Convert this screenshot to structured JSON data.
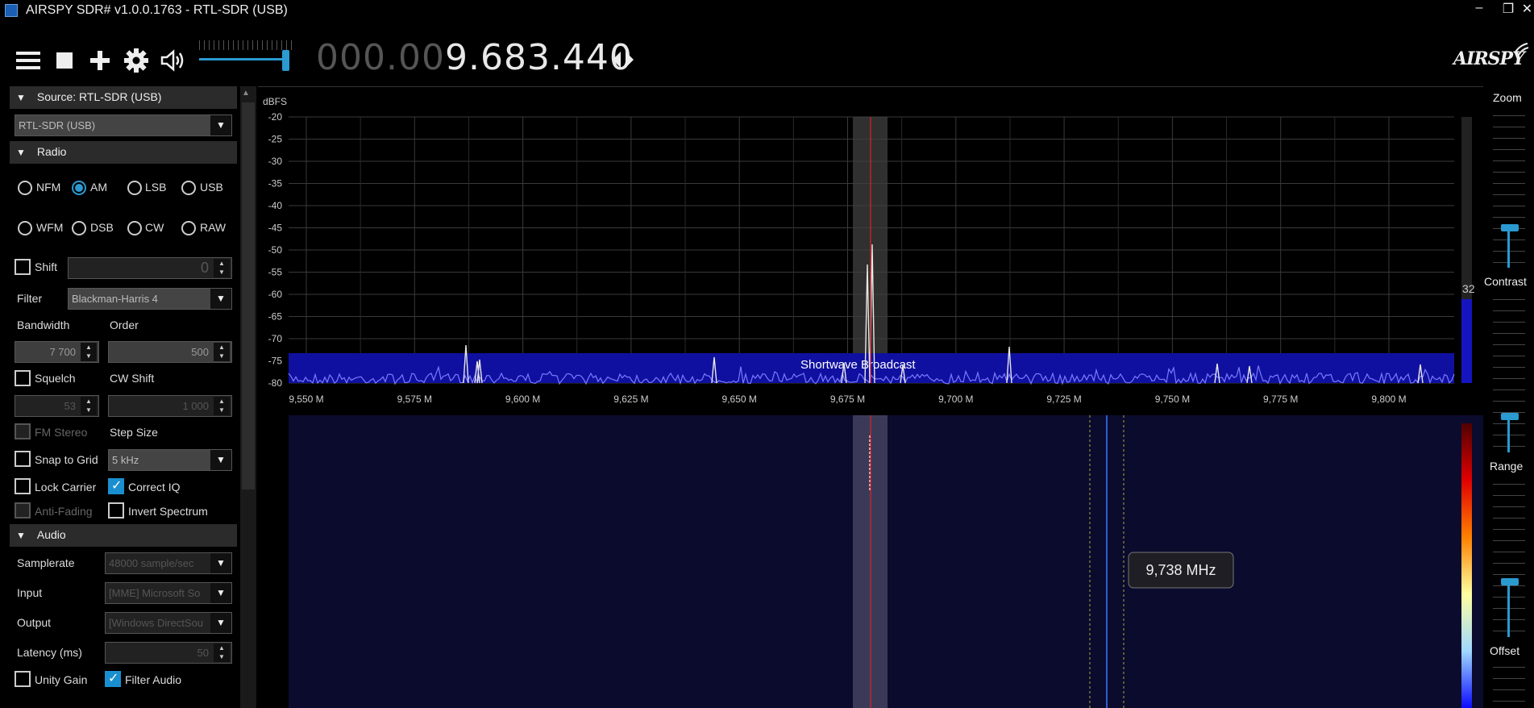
{
  "window": {
    "title": "AIRSPY SDR# v1.0.0.1763 - RTL-SDR (USB)",
    "minimize": "–",
    "restore": "❐",
    "close": "✕"
  },
  "toolbar": {
    "freq_dim": "000.00",
    "freq_bright": "9.683.440",
    "logo": "AIRSPY",
    "volume_level": 0.9,
    "icons": [
      "menu-icon",
      "stop-icon",
      "plus-icon",
      "gear-icon",
      "speaker-icon",
      "tune-arrows-icon"
    ]
  },
  "source": {
    "header": "Source: RTL-SDR (USB)",
    "device": "RTL-SDR (USB)"
  },
  "radio": {
    "header": "Radio",
    "modes": [
      "NFM",
      "AM",
      "LSB",
      "USB",
      "WFM",
      "DSB",
      "CW",
      "RAW"
    ],
    "selected_mode": "AM",
    "shift_label": "Shift",
    "shift_value": "0",
    "filter_label": "Filter",
    "filter_value": "Blackman-Harris 4",
    "bandwidth_label": "Bandwidth",
    "bandwidth_value": "7 700",
    "order_label": "Order",
    "order_value": "500",
    "squelch_label": "Squelch",
    "squelch_value": "53",
    "cw_shift_label": "CW Shift",
    "cw_shift_value": "1 000",
    "fm_stereo_label": "FM Stereo",
    "step_size_label": "Step Size",
    "snap_label": "Snap to Grid",
    "step_size_value": "5 kHz",
    "lock_carrier_label": "Lock Carrier",
    "correct_iq_label": "Correct IQ",
    "anti_fading_label": "Anti-Fading",
    "invert_spectrum_label": "Invert Spectrum"
  },
  "audio": {
    "header": "Audio",
    "samplerate_label": "Samplerate",
    "samplerate_value": "48000 sample/sec",
    "input_label": "Input",
    "input_value": "[MME] Microsoft So",
    "output_label": "Output",
    "output_value": "[Windows DirectSou",
    "latency_label": "Latency (ms)",
    "latency_value": "50",
    "unity_gain_label": "Unity Gain",
    "filter_audio_label": "Filter Audio"
  },
  "spectrum": {
    "unit": "dBFS",
    "band_label": "Shortwave Broadcast",
    "y_ticks": [
      "-20",
      "-25",
      "-30",
      "-35",
      "-40",
      "-45",
      "-50",
      "-55",
      "-60",
      "-65",
      "-70",
      "-75",
      "-80"
    ],
    "x_ticks": [
      "9,550 M",
      "9,575 M",
      "9,600 M",
      "9,625 M",
      "9,650 M",
      "9,675 M",
      "9,700 M",
      "9,725 M",
      "9,750 M",
      "9,775 M",
      "9,800 M"
    ],
    "level_readout": "32",
    "tooltip": "9,738 MHz"
  },
  "right_panel": {
    "zoom_label": "Zoom",
    "contrast_label": "Contrast",
    "range_label": "Range",
    "offset_label": "Offset"
  },
  "colors": {
    "accent": "#2a9ad0",
    "band": "#1010a0",
    "trace": "#6a6aff",
    "center_line": "#e02020",
    "waterfall_bg": "#0b0b2e"
  }
}
